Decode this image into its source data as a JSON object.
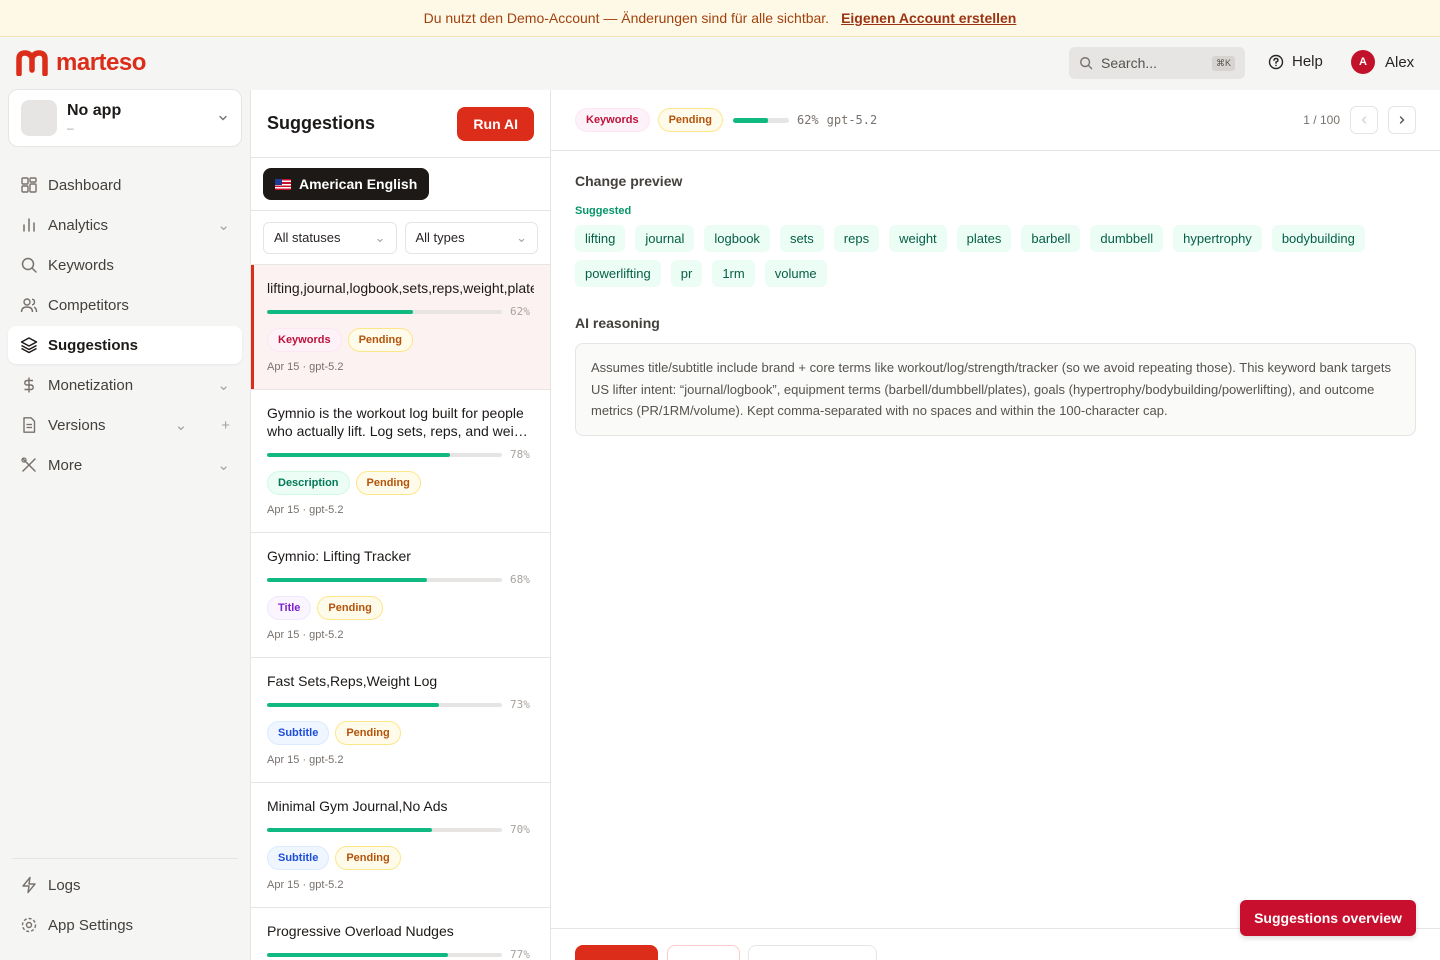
{
  "banner": {
    "text": "Du nutzt den Demo-Account — Änderungen sind für alle sichtbar.",
    "link": "Eigenen Account erstellen"
  },
  "brand": {
    "name": "marteso",
    "color": "#dc2d1a"
  },
  "header": {
    "search_placeholder": "Search...",
    "search_shortcut": "⌘K",
    "help": "Help",
    "user_name": "Alex",
    "user_initial": "A"
  },
  "app_selector": {
    "name": "No app",
    "sub": "–"
  },
  "nav": {
    "items": [
      {
        "label": "Dashboard",
        "icon": "dashboard-icon"
      },
      {
        "label": "Analytics",
        "icon": "analytics-icon"
      },
      {
        "label": "Keywords",
        "icon": "search-icon"
      },
      {
        "label": "Competitors",
        "icon": "users-icon"
      },
      {
        "label": "Suggestions",
        "icon": "layers-icon"
      },
      {
        "label": "Monetization",
        "icon": "dollar-icon"
      },
      {
        "label": "Versions",
        "icon": "document-icon"
      },
      {
        "label": "More",
        "icon": "tools-icon"
      }
    ],
    "bottom": [
      {
        "label": "Logs",
        "icon": "bolt-icon"
      },
      {
        "label": "App Settings",
        "icon": "gear-icon"
      }
    ]
  },
  "list": {
    "title": "Suggestions",
    "run_ai": "Run AI",
    "locale": "American English",
    "filter_status": "All statuses",
    "filter_type": "All types",
    "items": [
      {
        "text": "lifting,journal,logbook,sets,reps,weight,plates,barbell,dumbbell,hypertrophy,bodybuilding,powerlifting,pr,1rm,volume",
        "progress": 62,
        "pct": "62%",
        "type": "Keywords",
        "status": "Pending",
        "meta": "Apr 15 · gpt-5.2"
      },
      {
        "text": "Gymnio is the workout log built for people who actually lift. Log sets, reps, and weight in seconds.",
        "progress": 78,
        "pct": "78%",
        "type": "Description",
        "status": "Pending",
        "meta": "Apr 15 · gpt-5.2"
      },
      {
        "text": "Gymnio: Lifting Tracker",
        "progress": 68,
        "pct": "68%",
        "type": "Title",
        "status": "Pending",
        "meta": "Apr 15 · gpt-5.2"
      },
      {
        "text": "Fast Sets,Reps,Weight Log",
        "progress": 73,
        "pct": "73%",
        "type": "Subtitle",
        "status": "Pending",
        "meta": "Apr 15 · gpt-5.2"
      },
      {
        "text": "Minimal Gym Journal,No Ads",
        "progress": 70,
        "pct": "70%",
        "type": "Subtitle",
        "status": "Pending",
        "meta": "Apr 15 · gpt-5.2"
      },
      {
        "text": "Progressive Overload Nudges",
        "progress": 77,
        "pct": "77%",
        "type": "",
        "status": "",
        "meta": ""
      }
    ]
  },
  "detail": {
    "type_badge": "Keywords",
    "status_badge": "Pending",
    "progress": 62,
    "pct": "62%",
    "model": "gpt-5.2",
    "pager": "1 / 100",
    "change_preview": "Change preview",
    "suggested_label": "Suggested",
    "keywords": [
      "lifting",
      "journal",
      "logbook",
      "sets",
      "reps",
      "weight",
      "plates",
      "barbell",
      "dumbbell",
      "hypertrophy",
      "bodybuilding",
      "powerlifting",
      "pr",
      "1rm",
      "volume"
    ],
    "reasoning_label": "AI reasoning",
    "reasoning": "Assumes title/subtitle include brand + core terms like workout/log/strength/tracker (so we avoid repeating those). This keyword bank targets US lifter intent: “journal/logbook”, equipment terms (barbell/dumbbell/plates), goals (hypertrophy/bodybuilding/powerlifting), and outcome metrics (PR/1RM/volume). Kept comma-separated with no spaces and within the 100-character cap."
  },
  "overview_button": "Suggestions overview"
}
